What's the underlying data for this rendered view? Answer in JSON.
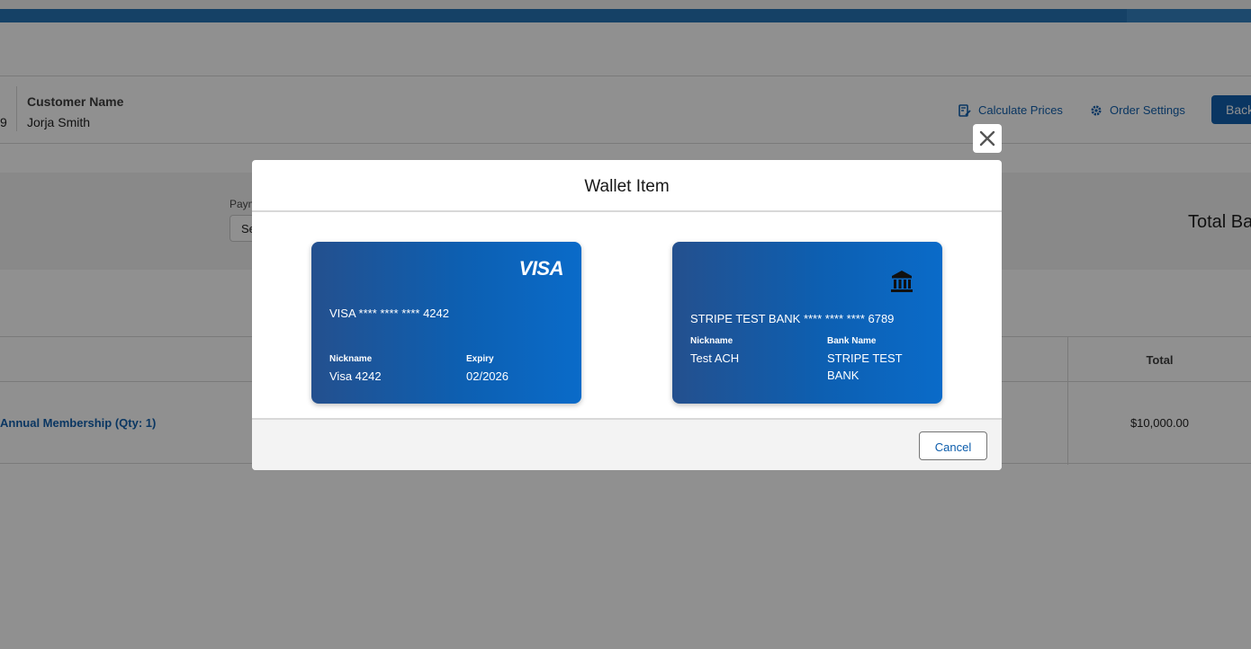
{
  "header": {
    "fragment": "9",
    "customer_label": "Customer Name",
    "customer_value": "Jorja Smith",
    "calculate_label": "Calculate Prices",
    "settings_label": "Order Settings",
    "back_label": "Back"
  },
  "panel": {
    "payment_label": "Payment",
    "payment_select_value": "Select",
    "total_balance_label": "Total Balance"
  },
  "table": {
    "total_header": "Total",
    "product": "Annual Membership (Qty: 1)",
    "total_value": "$10,000.00"
  },
  "modal": {
    "title": "Wallet Item",
    "cancel_label": "Cancel",
    "cards": [
      {
        "type": "card",
        "brand": "VISA",
        "number": "VISA **** **** **** 4242",
        "nickname_label": "Nickname",
        "nickname": "Visa 4242",
        "expiry_label": "Expiry",
        "expiry": "02/2026"
      },
      {
        "type": "bank",
        "icon": "bank-icon",
        "number": "STRIPE TEST BANK **** **** **** 6789",
        "nickname_label": "Nickname",
        "nickname": "Test ACH",
        "bank_label": "Bank Name",
        "bank_name": "STRIPE TEST BANK"
      }
    ]
  },
  "colors": {
    "brand_blue": "#0b5cab",
    "card_gradient_start": "#24508e",
    "card_gradient_end": "#0a6bc9"
  }
}
